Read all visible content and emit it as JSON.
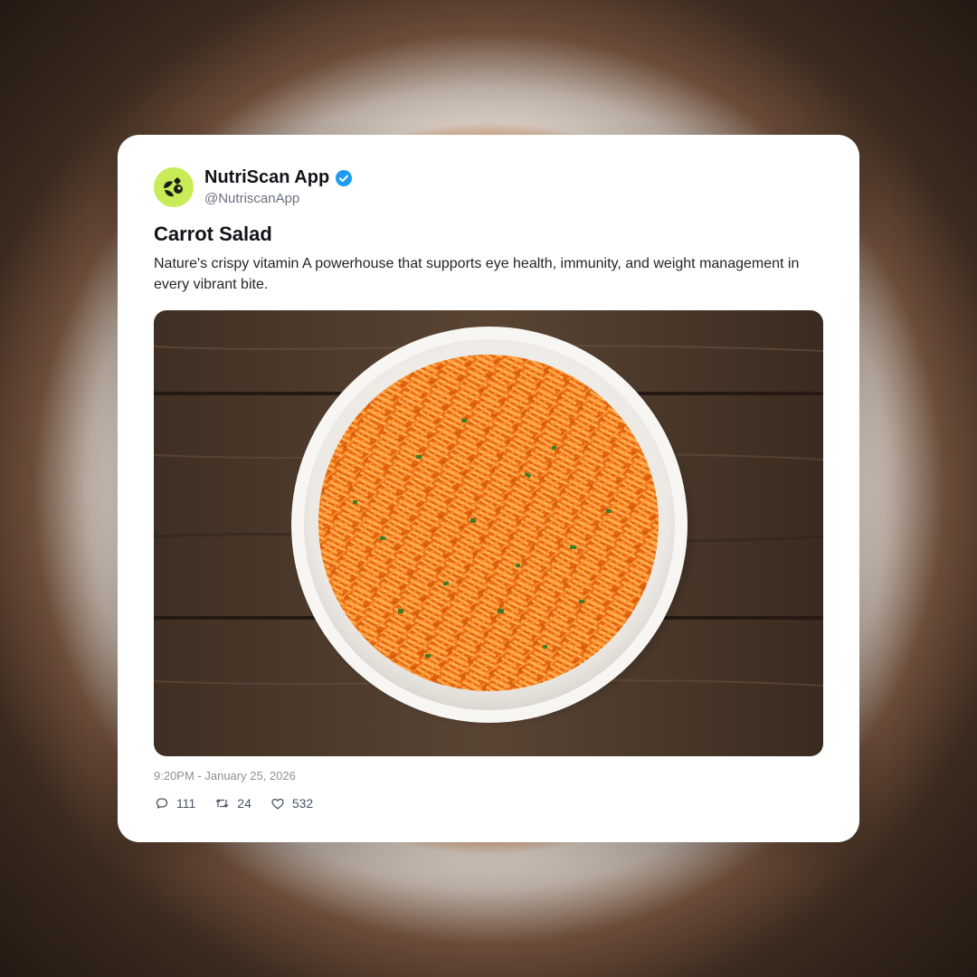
{
  "account": {
    "name": "NutriScan App",
    "handle": "@NutriscanApp",
    "verified": true,
    "avatar_icon": "leaf-logo-icon",
    "avatar_color": "#c8ec57"
  },
  "post": {
    "title": "Carrot Salad",
    "description": "Nature's crispy vitamin A powerhouse that supports eye health, immunity, and weight management in every vibrant bite.",
    "image_subject": "bowl of shredded carrot salad on wooden table",
    "timestamp": "9:20PM - January 25, 2026"
  },
  "stats": {
    "replies": "111",
    "reposts": "24",
    "likes": "532"
  },
  "colors": {
    "verified_badge": "#1d9bf0",
    "card_background": "#ffffff",
    "carrot_orange": "#f4781a"
  }
}
